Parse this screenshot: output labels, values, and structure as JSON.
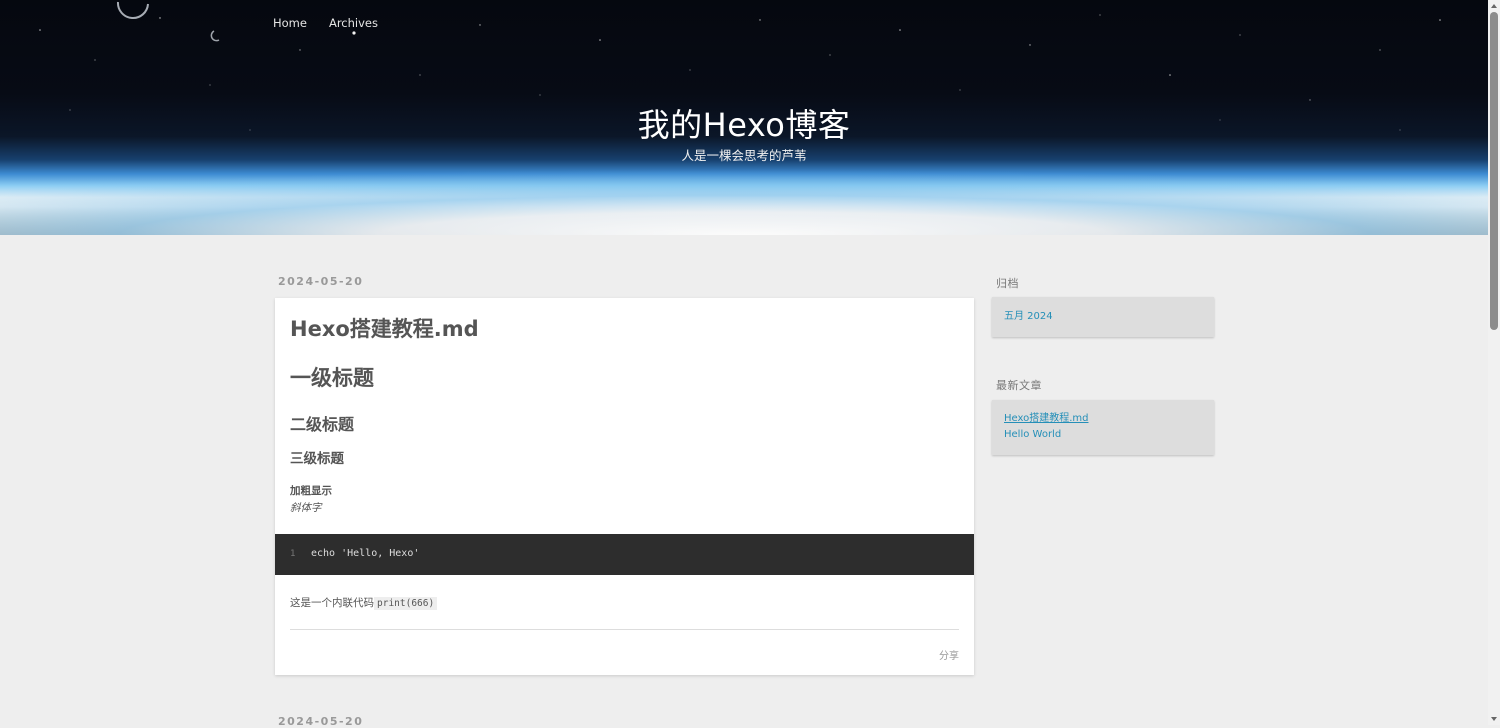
{
  "nav": {
    "items": [
      "Home",
      "Archives"
    ]
  },
  "site": {
    "title": "我的Hexo博客",
    "subtitle": "人是一棵会思考的芦苇"
  },
  "posts": [
    {
      "date": "2024-05-20",
      "title": "Hexo搭建教程.md",
      "h1": "一级标题",
      "h2": "二级标题",
      "h3": "三级标题",
      "bold_text": "加粗显示",
      "italic_text": "斜体字",
      "code": {
        "line_number": "1",
        "line": "echo 'Hello, Hexo'"
      },
      "inline_text": "这是一个内联代码",
      "inline_code": "print(666)",
      "share_label": "分享"
    },
    {
      "date": "2024-05-20"
    }
  ],
  "sidebar": {
    "archive": {
      "title": "归档",
      "items": [
        "五月 2024"
      ]
    },
    "recent": {
      "title": "最新文章",
      "items": [
        "Hexo搭建教程.md",
        "Hello World"
      ]
    }
  }
}
